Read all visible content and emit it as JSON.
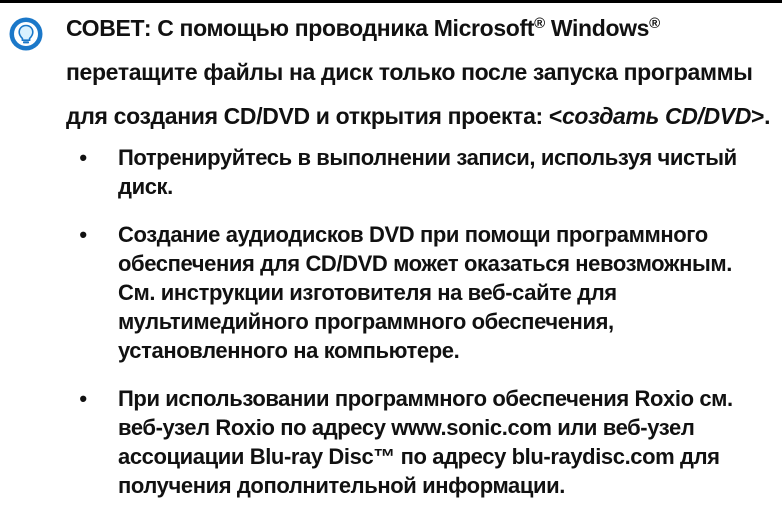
{
  "tip": {
    "label": "СОВЕТ:",
    "line1_a": " С помощью проводника Microsoft",
    "reg1": "®",
    "line1_b": " Windows",
    "reg2": "®",
    "line1_c": " перетащите файлы на диск только после запуска программы для создания CD/DVD и открытия проекта: ",
    "em_open": "<",
    "em_text": "создать CD/DVD",
    "em_close": ">",
    "end": "."
  },
  "bullets": [
    "Потренируйтесь в выполнении записи, используя чистый диск.",
    "Создание аудиодисков DVD при помощи программного обеспечения для CD/DVD может оказаться невозможным. См. инструкции изготовителя на веб-сайте для мультимедийного программного обеспечения, установленного на компьютере.",
    "При использовании программного обеспечения Roxio см. веб-узел Roxio по адресу www.sonic.com или веб-узел ассоциации Blu-ray Disc™ по адресу blu-raydisc.com для получения дополнительной информации."
  ],
  "bullet_symbol": "•",
  "icon": "lightbulb-tip-icon",
  "colors": {
    "icon_ring": "#1b78c9",
    "icon_fill": "#d9f1ff"
  }
}
